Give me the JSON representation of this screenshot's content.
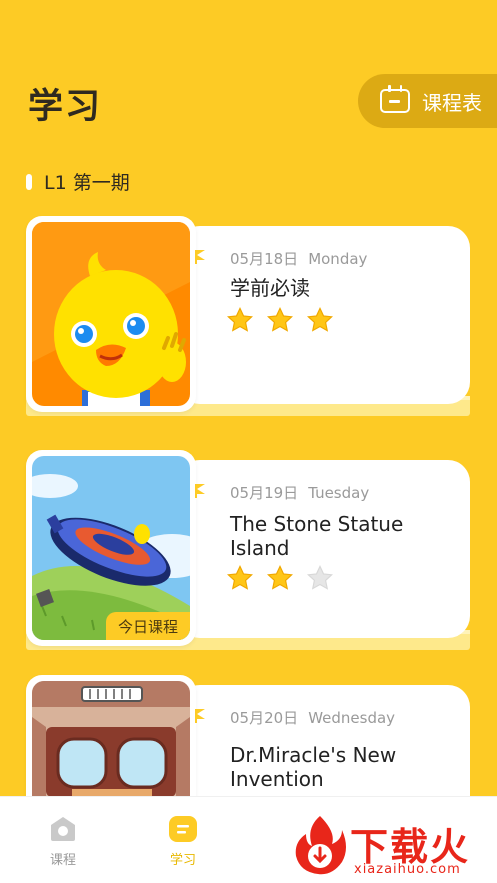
{
  "header": {
    "title": "学习",
    "schedule_label": "课程表",
    "accent": "#FDCB25"
  },
  "section": {
    "title": "L1 第一期"
  },
  "lessons": [
    {
      "date": "05月18日",
      "weekday": "Monday",
      "title": "学前必读",
      "stars": 3,
      "max_stars": 3,
      "today": false
    },
    {
      "date": "05月19日",
      "weekday": "Tuesday",
      "title": "The Stone Statue Island",
      "stars": 2,
      "max_stars": 3,
      "today": true,
      "badge": "今日课程"
    },
    {
      "date": "05月20日",
      "weekday": "Wednesday",
      "title": "Dr.Miracle's New Invention",
      "today": false
    }
  ],
  "tabbar": {
    "tabs": [
      {
        "label": "课程",
        "icon": "home-icon",
        "active": false
      },
      {
        "label": "学习",
        "icon": "study-icon",
        "active": true
      }
    ]
  },
  "watermark": {
    "text": "下载火",
    "url": "xiazaihuo.com"
  }
}
